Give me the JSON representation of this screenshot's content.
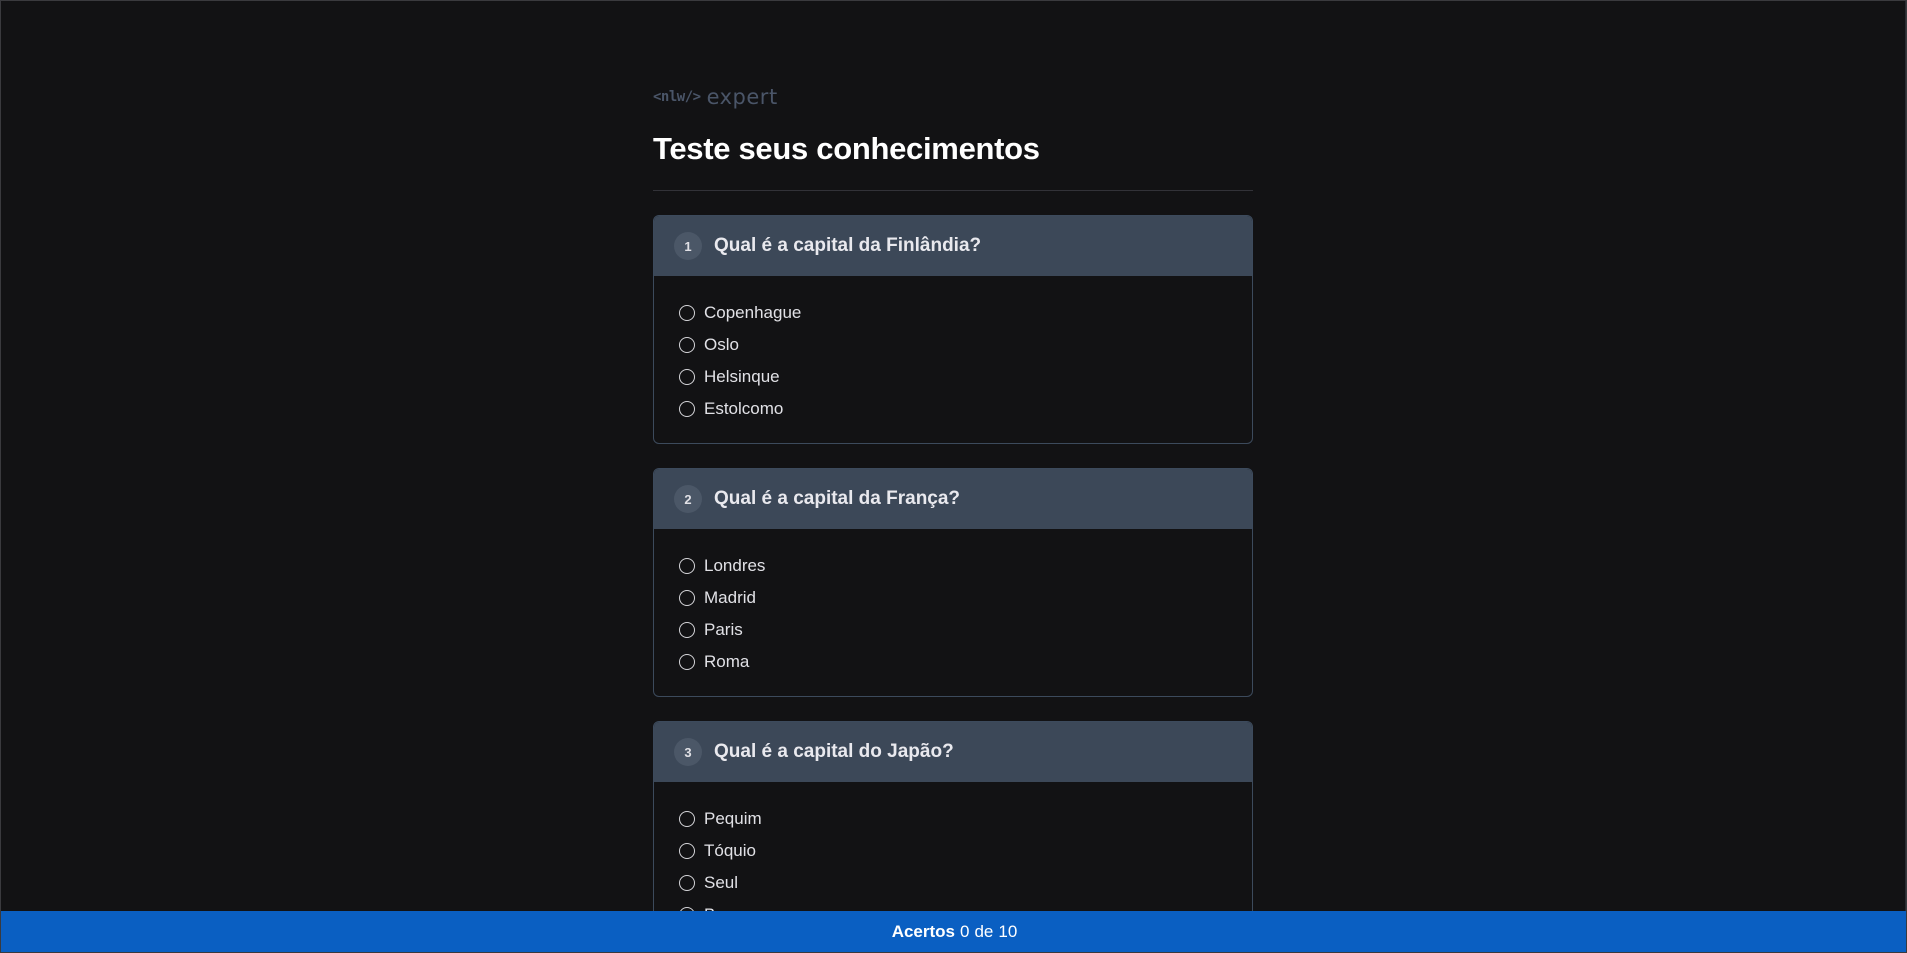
{
  "logo": {
    "code_text": "<nlw/>",
    "word_text": "expert"
  },
  "page_title": "Teste seus conhecimentos",
  "questions": [
    {
      "number": "1",
      "title": "Qual é a capital da Finlândia?",
      "options": [
        "Copenhague",
        "Oslo",
        "Helsinque",
        "Estolcomo"
      ]
    },
    {
      "number": "2",
      "title": "Qual é a capital da França?",
      "options": [
        "Londres",
        "Madrid",
        "Paris",
        "Roma"
      ]
    },
    {
      "number": "3",
      "title": "Qual é a capital do Japão?",
      "options": [
        "Pequim",
        "Tóquio",
        "Seul",
        "Bangcoc"
      ]
    }
  ],
  "footer": {
    "label": "Acertos",
    "correct": "0",
    "separator": "de",
    "total": "10"
  },
  "colors": {
    "background": "#121214",
    "question_header": "#3c4858",
    "footer": "#0a5fc2"
  }
}
